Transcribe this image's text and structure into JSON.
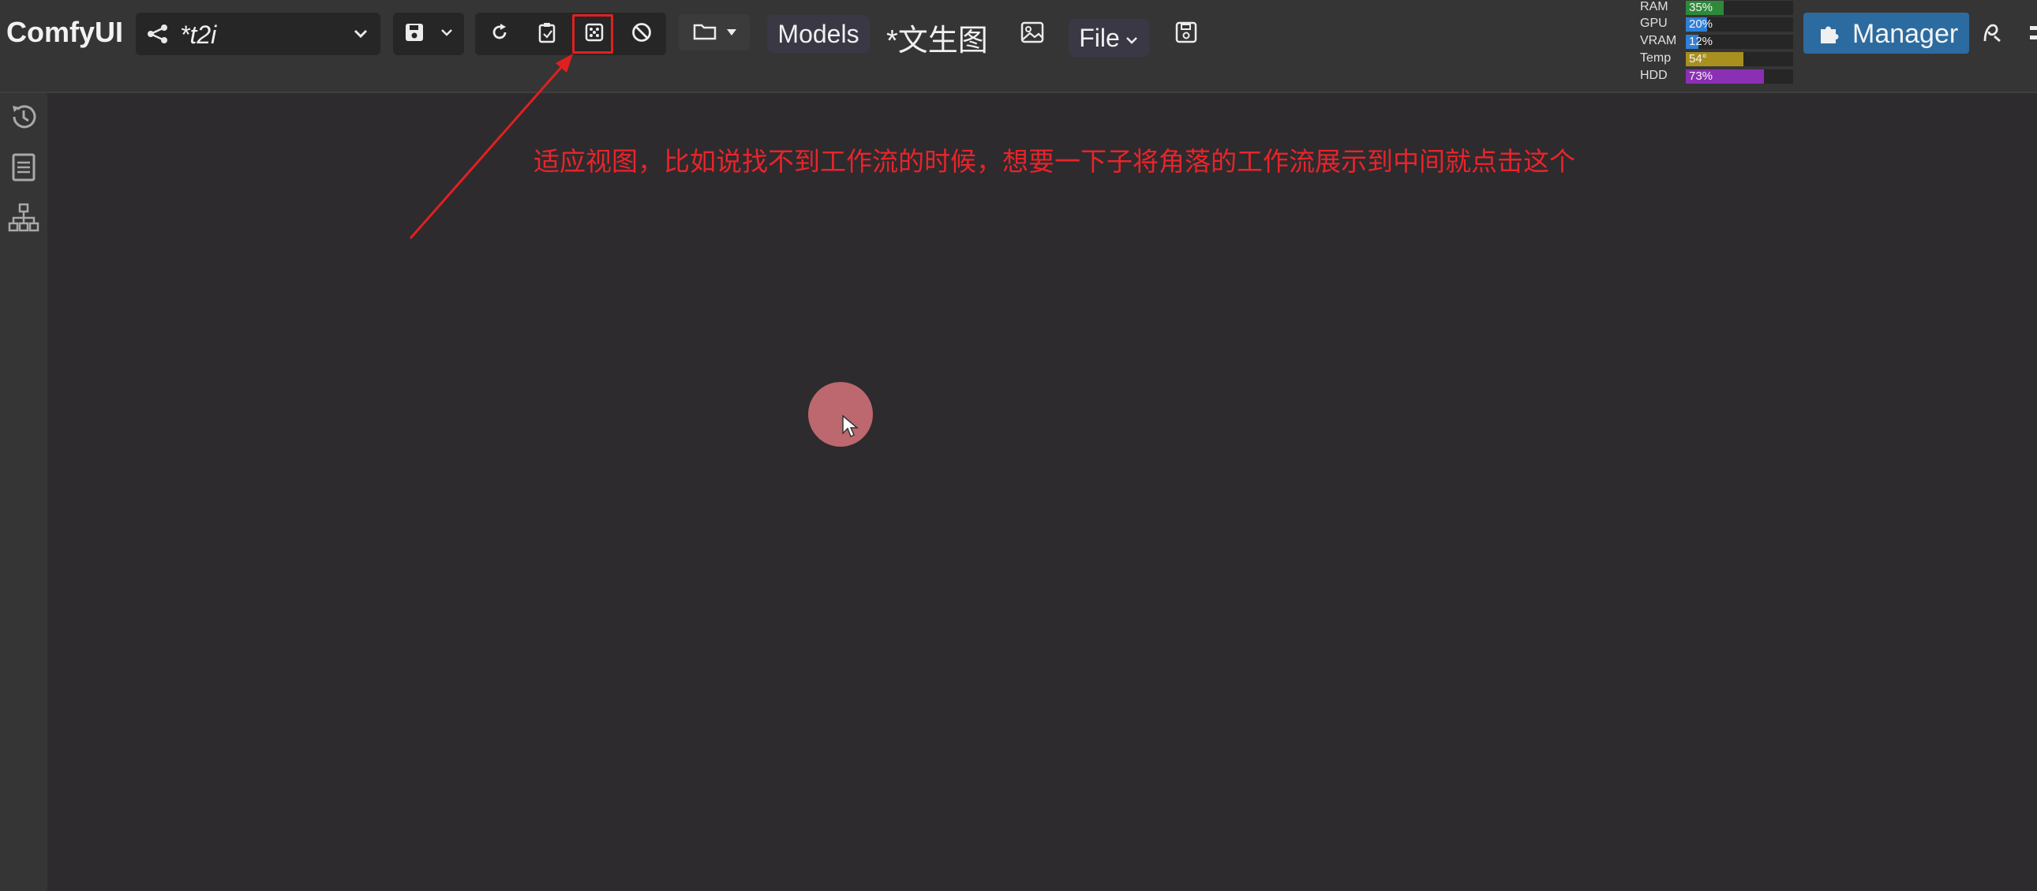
{
  "app": {
    "brand": "ComfyUI"
  },
  "workflow": {
    "name": "*t2i"
  },
  "toolbar": {
    "models_label": "Models",
    "tab_title": "*文生图",
    "file_label": "File"
  },
  "stats": [
    {
      "label": "RAM",
      "value": "35%",
      "fraction": 0.35,
      "color": "#2e8a3a"
    },
    {
      "label": "GPU",
      "value": "20%",
      "fraction": 0.2,
      "color": "#2f7fd8"
    },
    {
      "label": "VRAM",
      "value": "12%",
      "fraction": 0.12,
      "color": "#2f7fd8"
    },
    {
      "label": "Temp",
      "value": "54°",
      "fraction": 0.54,
      "color": "#a89020"
    },
    {
      "label": "HDD",
      "value": "73%",
      "fraction": 0.73,
      "color": "#8b2fb4"
    }
  ],
  "manager": {
    "label": "Manager",
    "color": "#2c6ba0"
  },
  "annotation": {
    "text": "适应视图，比如说找不到工作流的时候，想要一下子将角落的工作流展示到中间就点击这个",
    "color": "#e8242a"
  },
  "icons": [
    "share-icon",
    "chevron-down-icon",
    "save-icon",
    "refresh-icon",
    "clipboard-icon",
    "fit-view-icon",
    "cancel-icon",
    "folder-icon",
    "image-icon",
    "floppy-icon",
    "puzzle-icon",
    "history-icon",
    "queue-list-icon",
    "node-tree-icon"
  ]
}
